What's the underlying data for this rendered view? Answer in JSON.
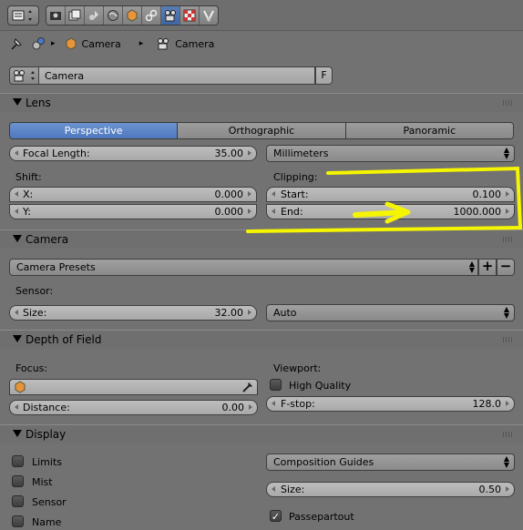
{
  "toolbar": {
    "menu_icon": "editor-type-icon",
    "buttons": [
      "render-icon",
      "render-layers-icon",
      "scene-icon",
      "world-icon",
      "object-icon",
      "constraints-icon",
      "camera-data-icon",
      "texture-icon",
      "physics-icon"
    ],
    "active_index": 6
  },
  "breadcrumb": {
    "item1": "Camera",
    "item2": "Camera"
  },
  "datablock": {
    "name": "Camera",
    "fake_user": "F"
  },
  "lens": {
    "title": "Lens",
    "tabs": [
      "Perspective",
      "Orthographic",
      "Panoramic"
    ],
    "active_tab": 0,
    "focal_length_label": "Focal Length:",
    "focal_length_value": "35.00",
    "unit": "Millimeters",
    "shift_label": "Shift:",
    "shift_x_label": "X:",
    "shift_x_value": "0.000",
    "shift_y_label": "Y:",
    "shift_y_value": "0.000",
    "clipping_label": "Clipping:",
    "clip_start_label": "Start:",
    "clip_start_value": "0.100",
    "clip_end_label": "End:",
    "clip_end_value": "1000.000"
  },
  "camera": {
    "title": "Camera",
    "presets": "Camera Presets",
    "sensor_label": "Sensor:",
    "size_label": "Size:",
    "size_value": "32.00",
    "fit": "Auto"
  },
  "dof": {
    "title": "Depth of Field",
    "focus_label": "Focus:",
    "distance_label": "Distance:",
    "distance_value": "0.00",
    "viewport_label": "Viewport:",
    "high_quality": "High Quality",
    "fstop_label": "F-stop:",
    "fstop_value": "128.0"
  },
  "display": {
    "title": "Display",
    "limits": "Limits",
    "mist": "Mist",
    "sensor": "Sensor",
    "name": "Name",
    "guides": "Composition Guides",
    "size_label": "Size:",
    "size_value": "0.50",
    "passepartout": "Passepartout"
  },
  "colors": {
    "active_blue": "#5a85c8",
    "annotation": "#f5f500"
  }
}
